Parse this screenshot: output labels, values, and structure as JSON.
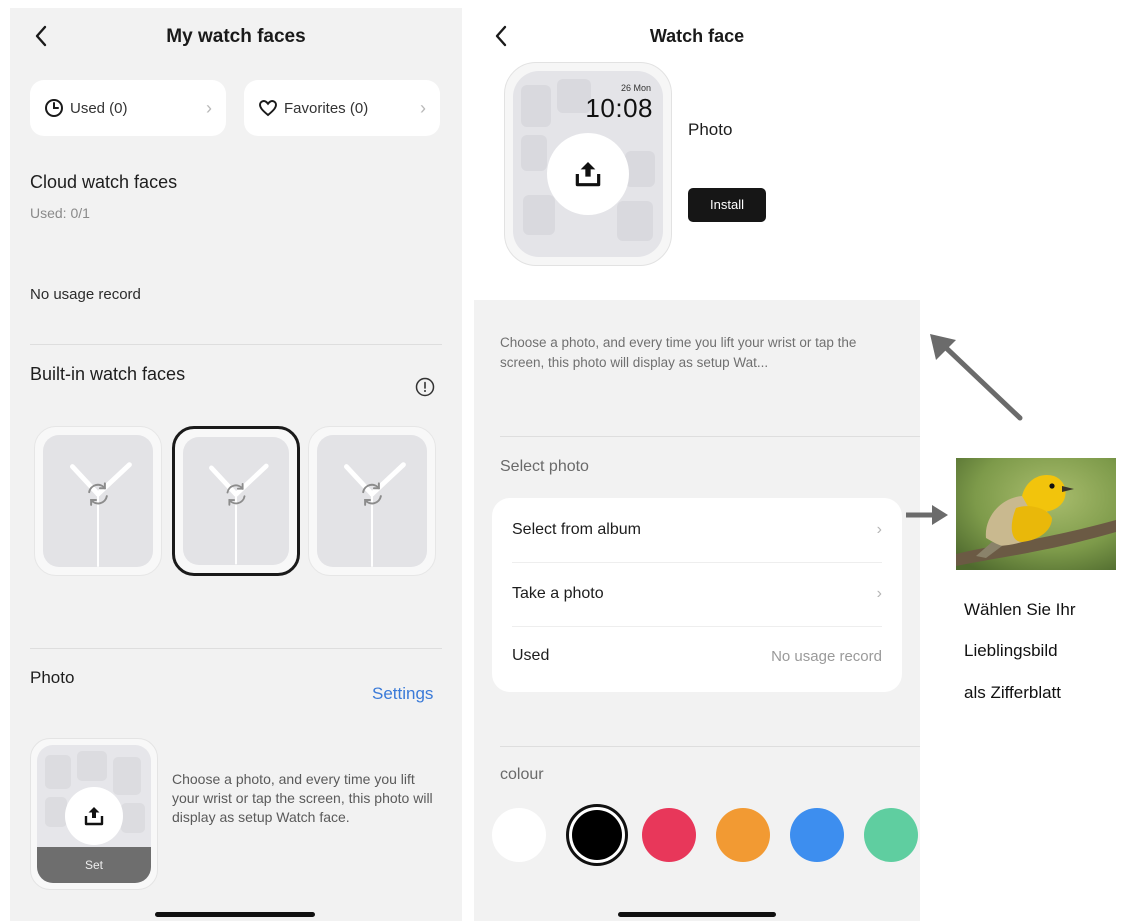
{
  "left": {
    "title": "My watch faces",
    "used_pill": "Used (0)",
    "favorites_pill": "Favorites (0)",
    "cloud_title": "Cloud watch faces",
    "cloud_used": "Used: 0/1",
    "no_record": "No usage record",
    "builtin_title": "Built-in watch faces",
    "photo_title": "Photo",
    "settings_link": "Settings",
    "set_label": "Set",
    "photo_desc": "Choose a photo, and every time you lift your wrist or tap the screen, this photo will display as setup Watch face."
  },
  "right": {
    "title": "Watch face",
    "watch_date": "26 Mon",
    "watch_time": "10:08",
    "face_name": "Photo",
    "install_label": "Install",
    "description": "Choose a photo, and every time you lift your wrist or tap the screen, this photo will display as setup Wat...",
    "select_title": "Select photo",
    "rows": [
      {
        "label": "Select from album"
      },
      {
        "label": "Take a photo"
      },
      {
        "label": "Used",
        "value": "No usage record"
      }
    ],
    "colour_title": "colour",
    "colours": [
      "#ffffff",
      "#000000",
      "#e8375a",
      "#f29a33",
      "#3d8eef",
      "#5fcea0"
    ]
  },
  "annotation": {
    "lines": [
      "Wählen Sie Ihr",
      "Lieblingsbild",
      "als Zifferblatt"
    ]
  },
  "icons": [
    "back-icon",
    "clock-icon",
    "heart-icon",
    "chevron-right-icon",
    "info-icon",
    "sync-icon",
    "upload-icon",
    "arrow-icon"
  ]
}
